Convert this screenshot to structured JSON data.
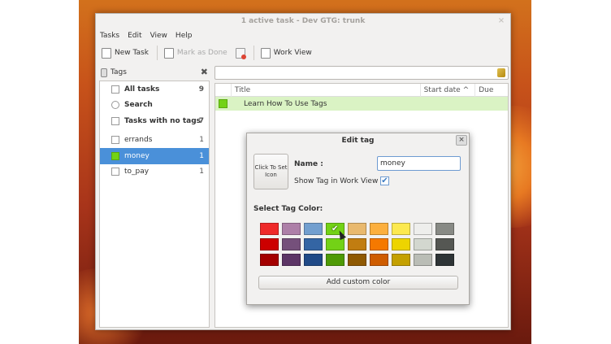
{
  "window": {
    "title": "1 active task - Dev GTG: trunk",
    "close_glyph": "×"
  },
  "menu": [
    "Tasks",
    "Edit",
    "View",
    "Help"
  ],
  "toolbar": {
    "new_task": "New Task",
    "mark_done": "Mark as Done",
    "work_view": "Work View"
  },
  "tags_pane": {
    "header": "Tags",
    "close_glyph": "✖",
    "items": [
      {
        "label": "All tasks",
        "count": "9"
      },
      {
        "label": "Search",
        "count": ""
      },
      {
        "label": "Tasks with no tags",
        "count": "7"
      },
      {
        "label": "errands",
        "count": "1"
      },
      {
        "label": "money",
        "count": "1"
      },
      {
        "label": "to_pay",
        "count": "1"
      }
    ]
  },
  "task_table": {
    "columns": [
      "Title",
      "Start date ^",
      "Due"
    ],
    "rows": [
      {
        "title": "Learn How To Use Tags",
        "tag_color": "#73d216"
      }
    ]
  },
  "dialog": {
    "title": "Edit tag",
    "close_glyph": "×",
    "icon_button": "Click To Set Icon",
    "name_label": "Name :",
    "name_value": "money",
    "show_label": "Show Tag in Work View :",
    "show_checked": true,
    "color_label": "Select Tag Color:",
    "selected_color": "#73d216",
    "palette": [
      "#ef2929",
      "#ad7fa8",
      "#729fcf",
      "#73d216",
      "#e9b96e",
      "#fcaf3e",
      "#fce94f",
      "#eeeeec",
      "#888a85",
      "#cc0000",
      "#75507b",
      "#3465a4",
      "#73d216",
      "#c17d11",
      "#f57900",
      "#edd400",
      "#d3d7cf",
      "#555753",
      "#a40000",
      "#5c3566",
      "#204a87",
      "#4e9a06",
      "#8f5902",
      "#ce5c00",
      "#c4a000",
      "#babdb6",
      "#2e3436"
    ],
    "custom_button": "Add custom color"
  },
  "colors": {
    "selection": "#4a90d9",
    "task_highlight": "#daf3c4"
  }
}
